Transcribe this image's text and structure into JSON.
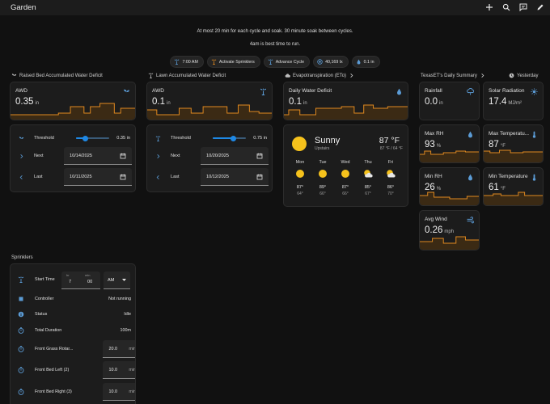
{
  "app": {
    "title": "Garden"
  },
  "info": {
    "line1": "At most 20 min for each cycle and soak. 30 minute soak between cycles.",
    "line2": "4am is best time to run."
  },
  "chips": [
    {
      "icon": "sprinkler-icon",
      "label": "7:00 AM"
    },
    {
      "icon": "sprinkler-icon",
      "label": "Activate Sprinklers"
    },
    {
      "icon": "sprinkler-icon",
      "label": "Advance Cycle"
    },
    {
      "icon": "brightness-icon",
      "label": "40,169 lx"
    },
    {
      "icon": "water-drop-icon",
      "label": "0.1 in"
    }
  ],
  "raised": {
    "title": "Raised Bed Accumulated Water Deficit",
    "card": {
      "label": "AWD",
      "value": "0.35",
      "unit": "in"
    },
    "threshold_label": "Threshold",
    "threshold_value": "0.35 in",
    "threshold_level": 0.29,
    "next_label": "Next",
    "next_date": "10/14/2025",
    "last_label": "Last",
    "last_date": "10/11/2025"
  },
  "lawn": {
    "title": "Lawn Accumulated Water Deficit",
    "card": {
      "label": "AWD",
      "value": "0.1",
      "unit": "in"
    },
    "threshold_label": "Threshold",
    "threshold_value": "0.75 in",
    "threshold_level": 0.63,
    "next_label": "Next",
    "next_date": "10/20/2025",
    "last_label": "Last",
    "last_date": "10/12/2025"
  },
  "et": {
    "title": "Evapotranspiration (ETo)",
    "card": {
      "label": "Daily Water Deficit",
      "value": "0.1",
      "unit": "in"
    }
  },
  "weather": {
    "condition": "Sunny",
    "location": "Upstairs",
    "temp": "87 °F",
    "hilo": "87 °F / 64 °F",
    "days": [
      {
        "day": "Mon",
        "icon": "sunny",
        "hi": "87°",
        "lo": "64°"
      },
      {
        "day": "Tue",
        "icon": "sunny",
        "hi": "89°",
        "lo": "66°"
      },
      {
        "day": "Wed",
        "icon": "sunny",
        "hi": "87°",
        "lo": "66°"
      },
      {
        "day": "Thu",
        "icon": "partly-cloudy",
        "hi": "85°",
        "lo": "67°"
      },
      {
        "day": "Fri",
        "icon": "partly-cloudy",
        "hi": "86°",
        "lo": "70°"
      }
    ]
  },
  "texaset": {
    "title": "TexasET's Daily Summary",
    "yesterday": "Yesterday",
    "cards": [
      {
        "label": "Rainfall",
        "value": "0.0",
        "unit": "in",
        "icon": "rain-cloud-icon"
      },
      {
        "label": "Solar Radiation",
        "value": "17.4",
        "unit": "MJ/m²",
        "icon": "sun-icon"
      },
      {
        "label": "Max RH",
        "value": "93",
        "unit": "%",
        "icon": "humidity-icon"
      },
      {
        "label": "Max Temperatu...",
        "value": "87",
        "unit": "°F",
        "icon": "thermometer-icon"
      },
      {
        "label": "Min RH",
        "value": "26",
        "unit": "%",
        "icon": "humidity-icon"
      },
      {
        "label": "Min Temperature",
        "value": "61",
        "unit": "°F",
        "icon": "thermometer-icon"
      },
      {
        "label": "Avg Wind",
        "value": "0.26",
        "unit": "mph",
        "icon": "wind-icon"
      }
    ]
  },
  "sprinklers": {
    "title": "Sprinklers",
    "start_label": "Start Time",
    "hr_label": "hr",
    "min_label": "min",
    "hour": "7",
    "minute": "00",
    "ampm": "AM",
    "rows": [
      {
        "label": "Controller",
        "value": "Not running",
        "icon": "controller-icon"
      },
      {
        "label": "Status",
        "value": "Idle",
        "icon": "info-icon"
      },
      {
        "label": "Total Duration",
        "value": "100m",
        "icon": "timer-icon"
      }
    ],
    "zones": [
      {
        "label": "Front Grass Rotar...",
        "value": "20.0",
        "unit": "min"
      },
      {
        "label": "Front Bed Left (2)",
        "value": "10.0",
        "unit": "min"
      },
      {
        "label": "Front Bed Right (3)",
        "value": "10.0",
        "unit": "min"
      }
    ]
  },
  "colors": {
    "accent": "#e0891f",
    "blue": "#1e88e5",
    "icon_blue": "#5b9bd5"
  }
}
